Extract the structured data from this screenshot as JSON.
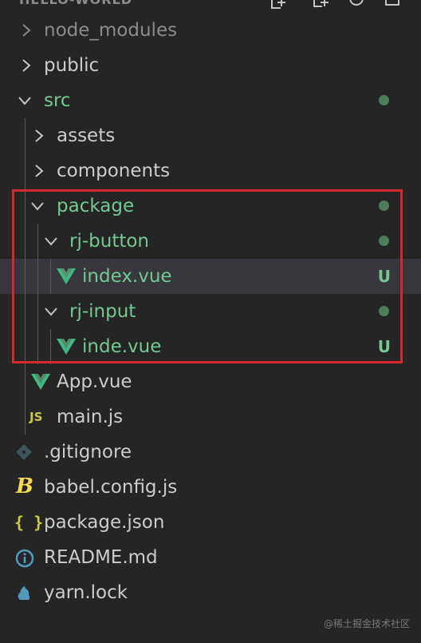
{
  "explorer": {
    "title": "HELLO-WORLD",
    "items": [
      {
        "label": "node_modules",
        "type": "folder",
        "state": "collapsed",
        "color": "dim"
      },
      {
        "label": "public",
        "type": "folder",
        "state": "collapsed",
        "color": "white"
      },
      {
        "label": "src",
        "type": "folder",
        "state": "expanded",
        "color": "green",
        "modified_dot": true
      },
      {
        "label": "assets",
        "type": "folder",
        "state": "collapsed",
        "color": "white"
      },
      {
        "label": "components",
        "type": "folder",
        "state": "collapsed",
        "color": "white"
      },
      {
        "label": "package",
        "type": "folder",
        "state": "expanded",
        "color": "green",
        "modified_dot": true
      },
      {
        "label": "rj-button",
        "type": "folder",
        "state": "expanded",
        "color": "green",
        "modified_dot": true
      },
      {
        "label": "index.vue",
        "type": "file",
        "icon": "vue-icon",
        "color": "green",
        "status": "U",
        "selected": true
      },
      {
        "label": "rj-input",
        "type": "folder",
        "state": "expanded",
        "color": "green",
        "modified_dot": true
      },
      {
        "label": "inde.vue",
        "type": "file",
        "icon": "vue-icon",
        "color": "green",
        "status": "U"
      },
      {
        "label": "App.vue",
        "type": "file",
        "icon": "vue-icon",
        "color": "white"
      },
      {
        "label": "main.js",
        "type": "file",
        "icon": "js-icon",
        "color": "white"
      },
      {
        "label": ".gitignore",
        "type": "file",
        "icon": "git-icon",
        "color": "white"
      },
      {
        "label": "babel.config.js",
        "type": "file",
        "icon": "babel-icon",
        "color": "white"
      },
      {
        "label": "package.json",
        "type": "file",
        "icon": "json-icon",
        "color": "white"
      },
      {
        "label": "README.md",
        "type": "file",
        "icon": "info-icon",
        "color": "white"
      },
      {
        "label": "yarn.lock",
        "type": "file",
        "icon": "yarn-icon",
        "color": "white"
      }
    ]
  },
  "icons": {
    "js_text": "JS",
    "json_text": "{ }",
    "babel_text": "B"
  },
  "colors": {
    "background": "#252526",
    "selected_row": "#37373d",
    "untracked_green": "#73c991",
    "highlight_border": "#d4282d",
    "vue_green": "#41b883"
  },
  "watermark": "@稀土掘金技术社区"
}
